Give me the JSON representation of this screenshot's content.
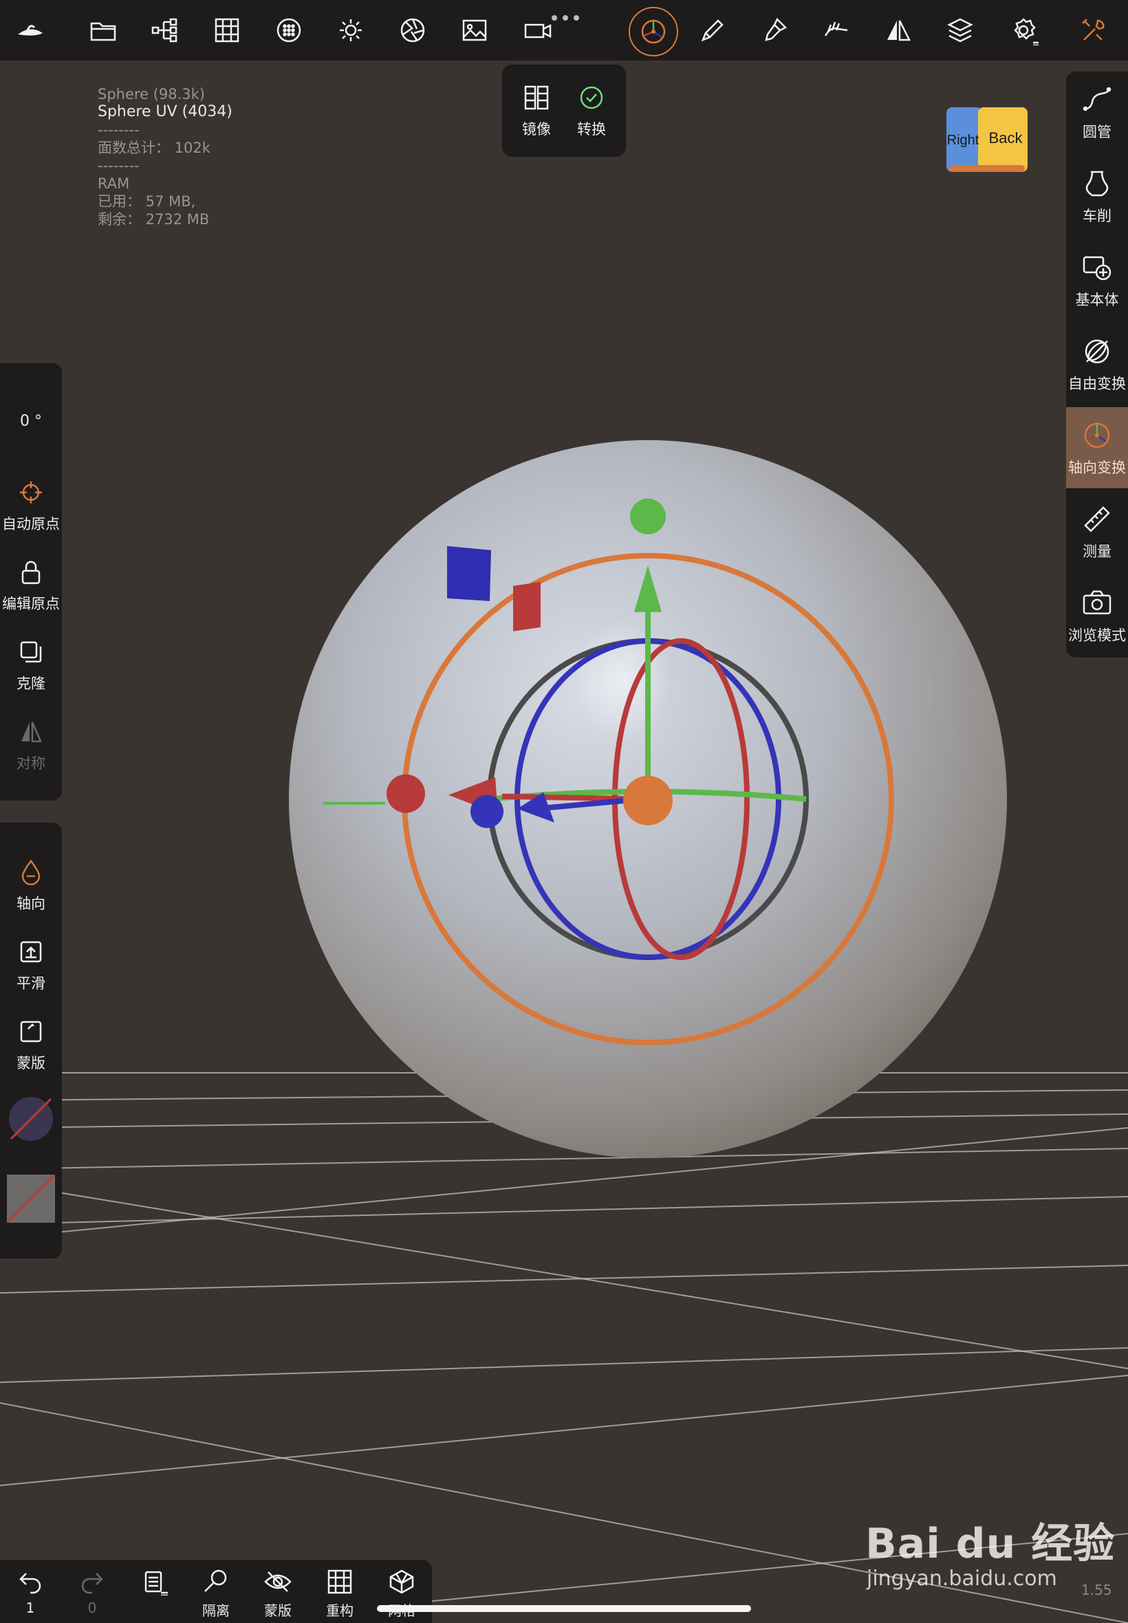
{
  "info": {
    "line1": "Sphere (98.3k)",
    "line2": "Sphere UV (4034)",
    "sep1": "--------",
    "faces": "面数总计： 102k",
    "sep2": "--------",
    "ram_title": "RAM",
    "ram_used": "已用： 57 MB,",
    "ram_free": "剩余： 2732 MB"
  },
  "popup": {
    "mirror": "镜像",
    "convert": "转换"
  },
  "view_cube": {
    "right": "Right",
    "back": "Back"
  },
  "right_toolbar": {
    "items": [
      {
        "label": "圆管",
        "icon": "tube-curve-icon"
      },
      {
        "label": "车削",
        "icon": "lathe-vase-icon"
      },
      {
        "label": "基本体",
        "icon": "primitive-add-icon"
      },
      {
        "label": "自由变换",
        "icon": "free-transform-icon"
      },
      {
        "label": "轴向变换",
        "icon": "gizmo-transform-icon",
        "active": true
      },
      {
        "label": "测量",
        "icon": "ruler-icon"
      },
      {
        "label": "浏览模式",
        "icon": "camera-icon"
      }
    ]
  },
  "left_panel_top": {
    "angle": "0 °",
    "items": [
      {
        "label": "自动原点",
        "icon": "crosshair-icon"
      },
      {
        "label": "编辑原点",
        "icon": "lock-icon"
      },
      {
        "label": "克隆",
        "icon": "clone-icon"
      },
      {
        "label": "对称",
        "icon": "symmetry-icon",
        "disabled": true
      }
    ]
  },
  "left_panel_bottom": {
    "items": [
      {
        "label": "轴向",
        "icon": "drop-icon"
      },
      {
        "label": "平滑",
        "icon": "smooth-upload-icon"
      },
      {
        "label": "蒙版",
        "icon": "mask-icon"
      }
    ]
  },
  "bottom_toolbar": {
    "undo_count": "1",
    "redo_count": "0",
    "items": [
      {
        "label": "隔离",
        "icon": "isolate-search-icon"
      },
      {
        "label": "蒙版",
        "icon": "eye-hidden-icon"
      },
      {
        "label": "重构",
        "icon": "grid-icon"
      },
      {
        "label": "网格",
        "icon": "mesh-icon"
      }
    ]
  },
  "zoom": "1.55",
  "watermark": {
    "logo": "Bai du 经验",
    "url": "jingyan.baidu.com"
  },
  "colors": {
    "toolbar": "#1d1b1c",
    "background": "#3a3431",
    "accent": "#d8783a",
    "active_item": "#7a5a49",
    "x_axis": "#b83a3a",
    "y_axis": "#5cb84b",
    "z_axis": "#3434b8"
  }
}
